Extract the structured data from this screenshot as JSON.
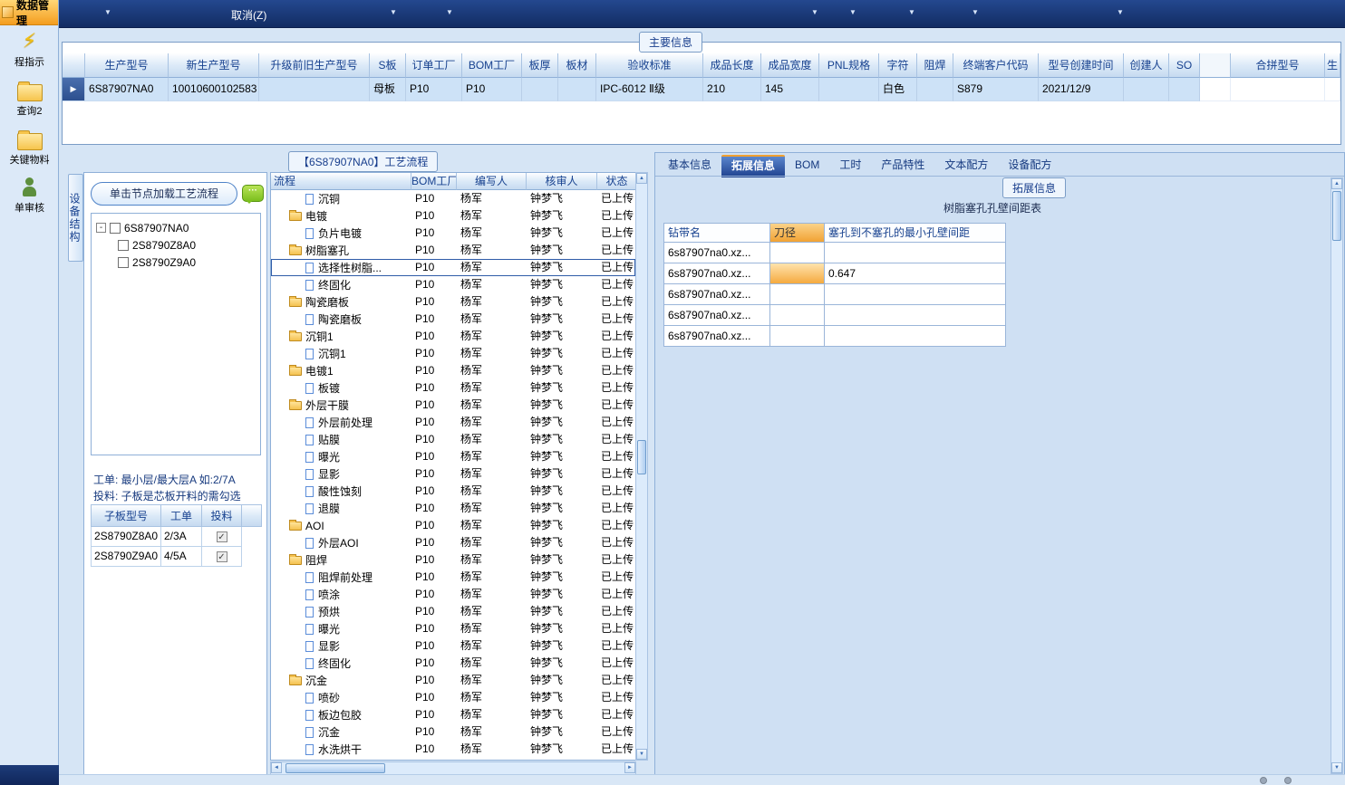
{
  "icons": {
    "dropdown": "▼",
    "row_arrow": "▶",
    "check": "✓",
    "minus": "-",
    "up_arrow": "▲",
    "down_arrow": "▼",
    "left_arrow": "◄",
    "right_arrow": "►",
    "lightning": "⚡",
    "comment_dots": "···"
  },
  "topbar": {
    "cancel_label": "取消(Z)"
  },
  "sidebar": {
    "header": "数据管理",
    "items": [
      {
        "label": "程指示",
        "icon": "lightning"
      },
      {
        "label": "查询2",
        "icon": "folder"
      },
      {
        "label": "关键物料",
        "icon": "folder"
      },
      {
        "label": "单审核",
        "icon": "user"
      }
    ]
  },
  "main_info": {
    "title": "主要信息",
    "columns": [
      "生产型号",
      "新生产型号",
      "升级前旧生产型号",
      "S板",
      "订单工厂",
      "BOM工厂",
      "板厚",
      "板材",
      "验收标准",
      "成品长度",
      "成品宽度",
      "PNL规格",
      "字符",
      "阻焊",
      "终端客户代码",
      "型号创建时间",
      "创建人",
      "SO"
    ],
    "extra_columns": [
      "合拼型号",
      "生"
    ],
    "row_values": [
      "6S87907NA0",
      "10010600102583",
      "",
      "母板",
      "P10",
      "P10",
      "",
      "",
      "IPC-6012 Ⅱ级",
      "210",
      "145",
      "",
      "白色",
      "",
      "S879",
      "2021/12/9",
      "",
      ""
    ]
  },
  "process_panel": {
    "title": "【6S87907NA0】工艺流程",
    "side_tab": "设备结构",
    "load_button": "单击节点加载工艺流程",
    "tree": {
      "root": "6S87907NA0",
      "children": [
        "2S8790Z8A0",
        "2S8790Z9A0"
      ]
    },
    "note1": "工单: 最小层/最大层A 如:2/7A",
    "note2": "投料: 子板是芯板开料的需勾选",
    "subtable": {
      "columns": [
        "子板型号",
        "工单",
        "投料"
      ],
      "rows": [
        {
          "model": "2S8790Z8A0",
          "order": "2/3A",
          "checked": true
        },
        {
          "model": "2S8790Z9A0",
          "order": "4/5A",
          "checked": true
        }
      ]
    }
  },
  "flow_table": {
    "columns": [
      "流程",
      "BOM工厂",
      "编写人",
      "核审人",
      "状态"
    ],
    "default_factory": "P10",
    "default_writer": "杨军",
    "default_reviewer": "钟梦飞",
    "default_status": "已上传",
    "rows": [
      {
        "name": "沉铜",
        "type": "leaf"
      },
      {
        "name": "电镀",
        "type": "folder"
      },
      {
        "name": "负片电镀",
        "type": "leaf"
      },
      {
        "name": "树脂塞孔",
        "type": "folder"
      },
      {
        "name": "选择性树脂...",
        "type": "leaf",
        "selected": true
      },
      {
        "name": "终固化",
        "type": "leaf"
      },
      {
        "name": "陶瓷磨板",
        "type": "folder"
      },
      {
        "name": "陶瓷磨板",
        "type": "leaf"
      },
      {
        "name": "沉铜1",
        "type": "folder"
      },
      {
        "name": "沉铜1",
        "type": "leaf"
      },
      {
        "name": "电镀1",
        "type": "folder"
      },
      {
        "name": "板镀",
        "type": "leaf"
      },
      {
        "name": "外层干膜",
        "type": "folder"
      },
      {
        "name": "外层前处理",
        "type": "leaf"
      },
      {
        "name": "贴膜",
        "type": "leaf"
      },
      {
        "name": "曝光",
        "type": "leaf"
      },
      {
        "name": "显影",
        "type": "leaf"
      },
      {
        "name": "酸性蚀刻",
        "type": "leaf"
      },
      {
        "name": "退膜",
        "type": "leaf"
      },
      {
        "name": "AOI",
        "type": "folder"
      },
      {
        "name": "外层AOI",
        "type": "leaf"
      },
      {
        "name": "阻焊",
        "type": "folder"
      },
      {
        "name": "阻焊前处理",
        "type": "leaf"
      },
      {
        "name": "喷涂",
        "type": "leaf"
      },
      {
        "name": "预烘",
        "type": "leaf"
      },
      {
        "name": "曝光",
        "type": "leaf"
      },
      {
        "name": "显影",
        "type": "leaf"
      },
      {
        "name": "终固化",
        "type": "leaf"
      },
      {
        "name": "沉金",
        "type": "folder"
      },
      {
        "name": "喷砂",
        "type": "leaf"
      },
      {
        "name": "板边包胶",
        "type": "leaf"
      },
      {
        "name": "沉金",
        "type": "leaf"
      },
      {
        "name": "水洗烘干",
        "type": "leaf"
      }
    ]
  },
  "right_panel": {
    "tabs": [
      "基本信息",
      "拓展信息",
      "BOM",
      "工时",
      "产品特性",
      "文本配方",
      "设备配方"
    ],
    "active_tab": "拓展信息",
    "group_label": "拓展信息",
    "table_title": "树脂塞孔孔壁间距表",
    "table": {
      "columns": [
        "钻带名",
        "刀径",
        "塞孔到不塞孔的最小孔壁间距"
      ],
      "rows": [
        {
          "drill": "6s87907na0.xz...",
          "diameter": "",
          "distance": ""
        },
        {
          "drill": "6s87907na0.xz...",
          "diameter": "",
          "distance": "0.647",
          "diameter_highlight": true
        },
        {
          "drill": "6s87907na0.xz...",
          "diameter": "",
          "distance": ""
        },
        {
          "drill": "6s87907na0.xz...",
          "diameter": "",
          "distance": ""
        },
        {
          "drill": "6s87907na0.xz...",
          "diameter": "",
          "distance": ""
        }
      ]
    }
  },
  "colors": {
    "accent_orange": "#f1a234",
    "header_navy": "#17418f",
    "topbar_navy": "#122c63",
    "row_highlight": "#cde2f7"
  }
}
